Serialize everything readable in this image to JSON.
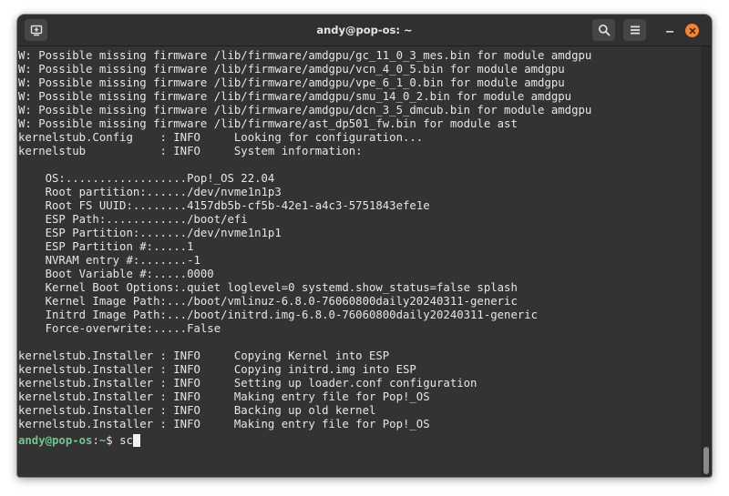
{
  "window": {
    "title": "andy@pop-os: ~"
  },
  "icons": {
    "new_tab": "new-tab-icon",
    "search": "search-icon",
    "menu": "hamburger-menu-icon",
    "minimize": "minimize-icon",
    "close": "close-icon"
  },
  "colors": {
    "terminal_bg": "#333333",
    "text": "#e6e6e6",
    "prompt": "#73c48f",
    "close_button": "#f08437"
  },
  "terminal": {
    "lines": [
      "W: Possible missing firmware /lib/firmware/amdgpu/gc_11_0_3_mes.bin for module amdgpu",
      "W: Possible missing firmware /lib/firmware/amdgpu/vcn_4_0_5.bin for module amdgpu",
      "W: Possible missing firmware /lib/firmware/amdgpu/vpe_6_1_0.bin for module amdgpu",
      "W: Possible missing firmware /lib/firmware/amdgpu/smu_14_0_2.bin for module amdgpu",
      "W: Possible missing firmware /lib/firmware/amdgpu/dcn_3_5_dmcub.bin for module amdgpu",
      "W: Possible missing firmware /lib/firmware/ast_dp501_fw.bin for module ast",
      "kernelstub.Config    : INFO     Looking for configuration...",
      "kernelstub           : INFO     System information:",
      "",
      "    OS:..................Pop!_OS 22.04",
      "    Root partition:....../dev/nvme1n1p3",
      "    Root FS UUID:........4157db5b-cf5b-42e1-a4c3-5751843efe1e",
      "    ESP Path:............/boot/efi",
      "    ESP Partition:......./dev/nvme1n1p1",
      "    ESP Partition #:.....1",
      "    NVRAM entry #:.......-1",
      "    Boot Variable #:.....0000",
      "    Kernel Boot Options:.quiet loglevel=0 systemd.show_status=false splash",
      "    Kernel Image Path:.../boot/vmlinuz-6.8.0-76060800daily20240311-generic",
      "    Initrd Image Path:.../boot/initrd.img-6.8.0-76060800daily20240311-generic",
      "    Force-overwrite:.....False",
      "",
      "kernelstub.Installer : INFO     Copying Kernel into ESP",
      "kernelstub.Installer : INFO     Copying initrd.img into ESP",
      "kernelstub.Installer : INFO     Setting up loader.conf configuration",
      "kernelstub.Installer : INFO     Making entry file for Pop!_OS",
      "kernelstub.Installer : INFO     Backing up old kernel",
      "kernelstub.Installer : INFO     Making entry file for Pop!_OS"
    ],
    "prompt": {
      "user_host": "andy@pop-os",
      "separator": ":",
      "path": "~",
      "symbol": "$ ",
      "input": "sc"
    }
  }
}
